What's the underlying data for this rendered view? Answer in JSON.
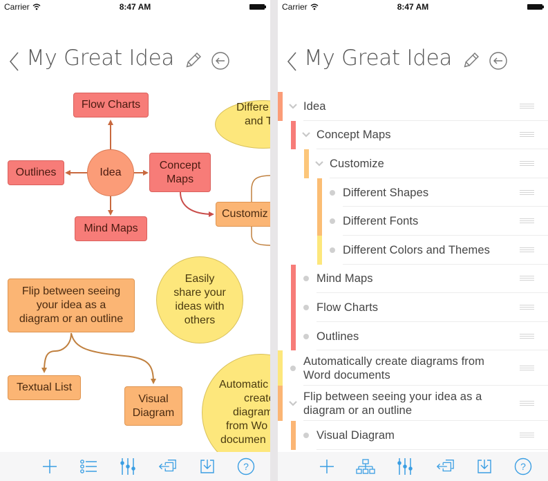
{
  "status_bar": {
    "carrier": "Carrier",
    "time": "8:47 AM"
  },
  "title": "My Great Idea",
  "colors": {
    "accent_blue": "#3a9ee3",
    "red": "#f77c78",
    "orange": "#fbb574",
    "salmon": "#fb9c78",
    "yellow": "#fde77c"
  },
  "diagram": {
    "nodes": {
      "idea": "Idea",
      "flow_charts": "Flow Charts",
      "outlines": "Outlines",
      "concept_maps_1": "Concept",
      "concept_maps_2": "Maps",
      "mind_maps": "Mind Maps",
      "customize": "Customiz",
      "different_1": "Differe",
      "different_2": "and T",
      "share_1": "Easily",
      "share_2": "share your",
      "share_3": "ideas with",
      "share_4": "others",
      "flip_1": "Flip between seeing",
      "flip_2": "your idea as a",
      "flip_3": "diagram or an outline",
      "textual_list": "Textual List",
      "visual_1": "Visual",
      "visual_2": "Diagram",
      "auto_1": "Automatic",
      "auto_2": "create",
      "auto_3": "diagram",
      "auto_4": "from Wo",
      "auto_5": "documen"
    }
  },
  "outline": {
    "rows": [
      {
        "label": "Idea",
        "level": 0,
        "expander": "chevron",
        "color": "#fb9c78"
      },
      {
        "label": "Concept Maps",
        "level": 1,
        "expander": "chevron",
        "color": "#f77c78"
      },
      {
        "label": "Customize",
        "level": 2,
        "expander": "chevron",
        "color": "#fcc67a"
      },
      {
        "label": "Different Shapes",
        "level": 3,
        "expander": "dot",
        "color": "#fbbd74"
      },
      {
        "label": "Different Fonts",
        "level": 3,
        "expander": "dot",
        "color": "#fbbd74"
      },
      {
        "label": "Different Colors and Themes",
        "level": 3,
        "expander": "dot",
        "color": "#fde77c"
      },
      {
        "label": "Mind Maps",
        "level": 1,
        "expander": "dot",
        "color": "#f77c78"
      },
      {
        "label": "Flow Charts",
        "level": 1,
        "expander": "dot",
        "color": "#f77c78"
      },
      {
        "label": "Outlines",
        "level": 1,
        "expander": "dot",
        "color": "#f77c78"
      },
      {
        "label": "Automatically create diagrams from Word documents",
        "label_line1": "Automatically create diagrams from",
        "label_line2": "Word documents",
        "level": 0,
        "expander": "dot",
        "color": "#fde77c"
      },
      {
        "label": "Flip between seeing your idea as a diagram or an outline",
        "label_line1": "Flip between seeing your idea as a",
        "label_line2": "diagram or an outline",
        "level": 0,
        "expander": "chevron",
        "color": "#fbb574"
      },
      {
        "label": "Visual Diagram",
        "level": 1,
        "expander": "dot",
        "color": "#fbb574"
      }
    ]
  },
  "toolbar_left": [
    "add-icon",
    "outline-view-icon",
    "sliders-icon",
    "export-icon",
    "download-icon",
    "help-icon"
  ],
  "toolbar_right": [
    "add-icon",
    "diagram-view-icon",
    "sliders-icon",
    "export-icon",
    "download-icon",
    "help-icon"
  ]
}
